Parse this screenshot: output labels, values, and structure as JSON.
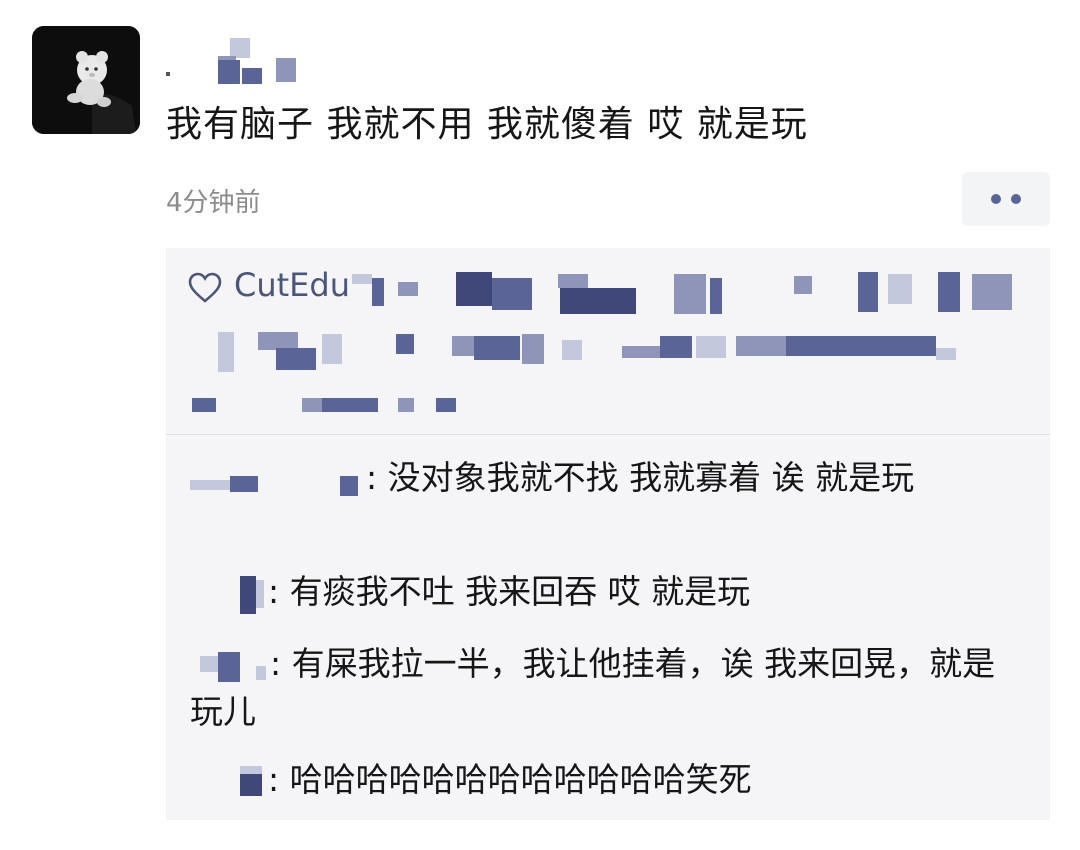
{
  "post": {
    "text": "我有脑子 我就不用 我就傻着 哎 就是玩",
    "timestamp": "4分钟前",
    "more_icon": "more-dots-icon"
  },
  "avatar": {
    "icon": "teddy-bear-avatar"
  },
  "likes": {
    "icon": "heart-outline-icon",
    "first_name_visible": "CutEdu"
  },
  "comments": [
    {
      "separator": ":",
      "text": "没对象我就不找  我就寡着  诶  就是玩"
    },
    {
      "separator": ":",
      "text": "有痰我不吐 我来回吞 哎 就是玩"
    },
    {
      "separator": ":",
      "text": "有屎我拉一半，我让他挂着，诶 我来回晃，就是玩儿"
    },
    {
      "separator": ":",
      "text": "哈哈哈哈哈哈哈哈哈哈哈哈笑死"
    }
  ],
  "colors": {
    "link_blue": "#4c5677",
    "panel_bg": "#f5f5f7",
    "timestamp_gray": "#8c8c8c"
  }
}
